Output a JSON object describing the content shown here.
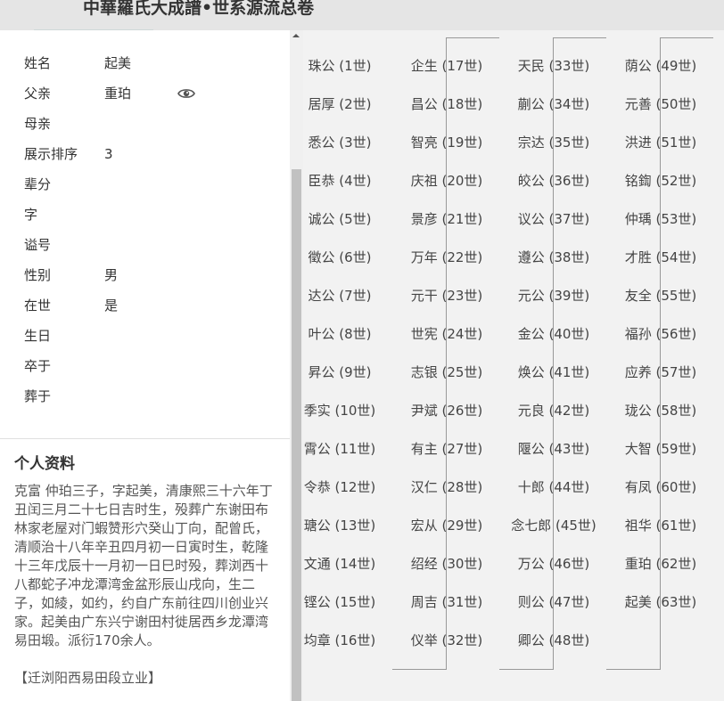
{
  "header": {
    "site_title": "中華羅氏大成譜•世系源流总卷"
  },
  "person": {
    "fields": [
      {
        "label": "姓名",
        "value": "起美"
      },
      {
        "label": "父亲",
        "value": "重珀"
      },
      {
        "label": "母亲",
        "value": ""
      },
      {
        "label": "展示排序",
        "value": "3"
      },
      {
        "label": "辈分",
        "value": ""
      },
      {
        "label": "字",
        "value": ""
      },
      {
        "label": "谥号",
        "value": ""
      },
      {
        "label": "性别",
        "value": "男"
      },
      {
        "label": "在世",
        "value": "是"
      },
      {
        "label": "生日",
        "value": ""
      },
      {
        "label": "卒于",
        "value": ""
      },
      {
        "label": "葬于",
        "value": ""
      }
    ]
  },
  "bio": {
    "title": "个人资料",
    "text": "克富 仲珀三子，字起美，清康熙三十六年丁丑闰三月二十七日吉时生，殁葬广东谢田布林家老屋对门蝦赞形穴癸山丁向，配曾氏，清顺治十八年辛丑四月初一日寅时生，乾隆十三年戊辰十一月初一日巳时殁，葬浏西十八都蛇子冲龙潭湾金盆形辰山戌向，生二子，如綾，如约，约自广东前往四川创业兴家。起美由广东兴宁谢田村徙居西乡龙潭湾易田塅。派衍170余人。",
    "note": "【迁浏阳西易田段立业】"
  },
  "icons": {
    "eye": "eye-icon"
  },
  "generations": {
    "columns": [
      [
        "珠公 (1世)",
        "居厚 (2世)",
        "悉公 (3世)",
        "臣恭 (4世)",
        "诚公 (5世)",
        "徵公 (6世)",
        "达公 (7世)",
        "叶公 (8世)",
        "昇公 (9世)",
        "季实 (10世)",
        "霄公 (11世)",
        "令恭 (12世)",
        "瑭公 (13世)",
        "文通 (14世)",
        "铿公 (15世)",
        "均章 (16世)"
      ],
      [
        "企生 (17世)",
        "昌公 (18世)",
        "智亮 (19世)",
        "庆祖 (20世)",
        "景彦 (21世)",
        "万年 (22世)",
        "元干 (23世)",
        "世宪 (24世)",
        "志银 (25世)",
        "尹斌 (26世)",
        "有主 (27世)",
        "汉仁 (28世)",
        "宏从 (29世)",
        "绍经 (30世)",
        "周吉 (31世)",
        "仪举 (32世)"
      ],
      [
        "天民 (33世)",
        "蒯公 (34世)",
        "宗达 (35世)",
        "皎公 (36世)",
        "议公 (37世)",
        "遵公 (38世)",
        "元公 (39世)",
        "金公 (40世)",
        "焕公 (41世)",
        "元良 (42世)",
        "隁公 (43世)",
        "十郎 (44世)",
        "念七郎 (45世)",
        "万公 (46世)",
        "则公 (47世)",
        "卿公 (48世)"
      ],
      [
        "荫公 (49世)",
        "元善 (50世)",
        "洪进 (51世)",
        "铭鍧 (52世)",
        "仲瑀 (53世)",
        "才胜 (54世)",
        "友全 (55世)",
        "福孙 (56世)",
        "应养 (57世)",
        "珑公 (58世)",
        "大智 (59世)",
        "有凤 (60世)",
        "祖华 (61世)",
        "重珀 (62世)",
        "起美 (63世)"
      ]
    ]
  }
}
